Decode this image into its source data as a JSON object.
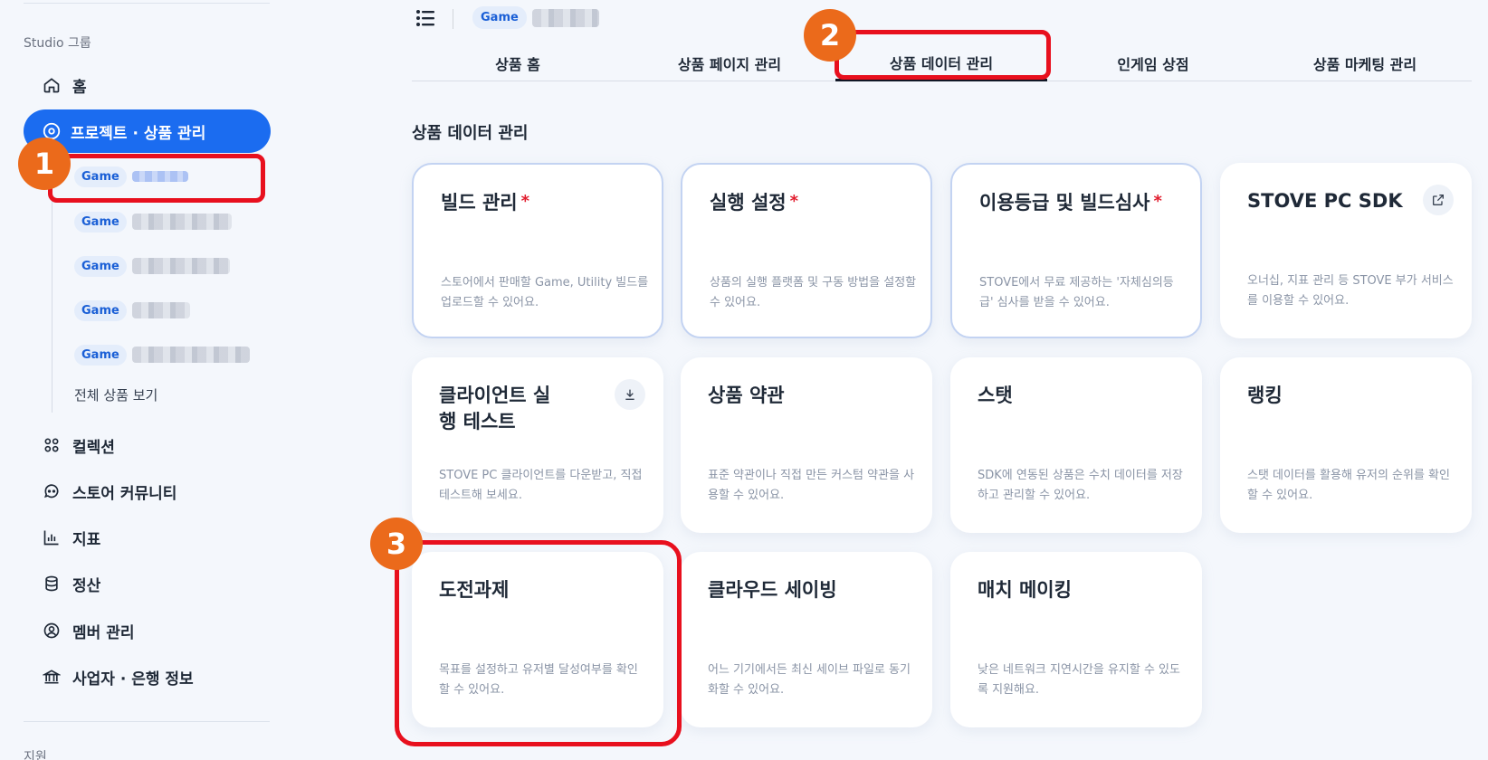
{
  "sidebar": {
    "group_label": "Studio 그룹",
    "home": "홈",
    "active_item": "프로젝트 · 상품 관리",
    "sub_items": [
      {
        "pill": "Game"
      },
      {
        "pill": "Game"
      },
      {
        "pill": "Game"
      },
      {
        "pill": "Game"
      },
      {
        "pill": "Game"
      }
    ],
    "all_products": "전체 상품 보기",
    "items": [
      {
        "label": "컬렉션",
        "icon": "collection-icon"
      },
      {
        "label": "스토어 커뮤니티",
        "icon": "community-icon"
      },
      {
        "label": "지표",
        "icon": "chart-icon"
      },
      {
        "label": "정산",
        "icon": "database-icon"
      },
      {
        "label": "멤버 관리",
        "icon": "member-icon"
      },
      {
        "label": "사업자 · 은행 정보",
        "icon": "bank-icon"
      }
    ],
    "support_label": "지원"
  },
  "header": {
    "pill": "Game",
    "tabs": [
      "상품 홈",
      "상품 페이지 관리",
      "상품 데이터 관리",
      "인게임 상점",
      "상품 마케팅 관리"
    ],
    "active_tab": "상품 데이터 관리"
  },
  "main": {
    "section_title": "상품 데이터 관리",
    "cards": [
      {
        "title": "빌드 관리",
        "required": "*",
        "desc": "스토어에서 판매할 Game, Utility 빌드를 업로드할 수 있어요."
      },
      {
        "title": "실행 설정",
        "required": "*",
        "desc": "상품의 실행 플랫폼 및 구동 방법을 설정할 수 있어요."
      },
      {
        "title": "이용등급 및 빌드심사",
        "required": "*",
        "desc": "STOVE에서 무료 제공하는 '자체심의등급' 심사를 받을 수 있어요."
      },
      {
        "title": "STOVE PC SDK",
        "desc": "오너십, 지표 관리 등 STOVE 부가 서비스를 이용할 수 있어요.",
        "icon": "external-link-icon"
      },
      {
        "title": "클라이언트 실행 테스트",
        "desc": "STOVE PC 클라이언트를 다운받고, 직접 테스트해 보세요.",
        "icon": "download-icon"
      },
      {
        "title": "상품 약관",
        "desc": "표준 약관이나 직접 만든 커스텀 약관을 사용할 수 있어요."
      },
      {
        "title": "스탯",
        "desc": "SDK에 연동된 상품은 수치 데이터를 저장하고 관리할 수 있어요."
      },
      {
        "title": "랭킹",
        "desc": "스탯 데이터를 활용해 유저의 순위를 확인할 수 있어요."
      },
      {
        "title": "도전과제",
        "desc": "목표를 설정하고 유저별 달성여부를 확인할 수 있어요."
      },
      {
        "title": "클라우드 세이빙",
        "desc": "어느 기기에서든 최신 세이브 파일로 동기화할 수 있어요."
      },
      {
        "title": "매치 메이킹",
        "desc": "낮은 네트워크 지연시간을 유지할 수 있도록 지원해요."
      }
    ]
  },
  "annotations": {
    "badges": [
      "1",
      "2",
      "3"
    ],
    "color": "#e8101e",
    "badge_color": "#eb6a1b"
  }
}
